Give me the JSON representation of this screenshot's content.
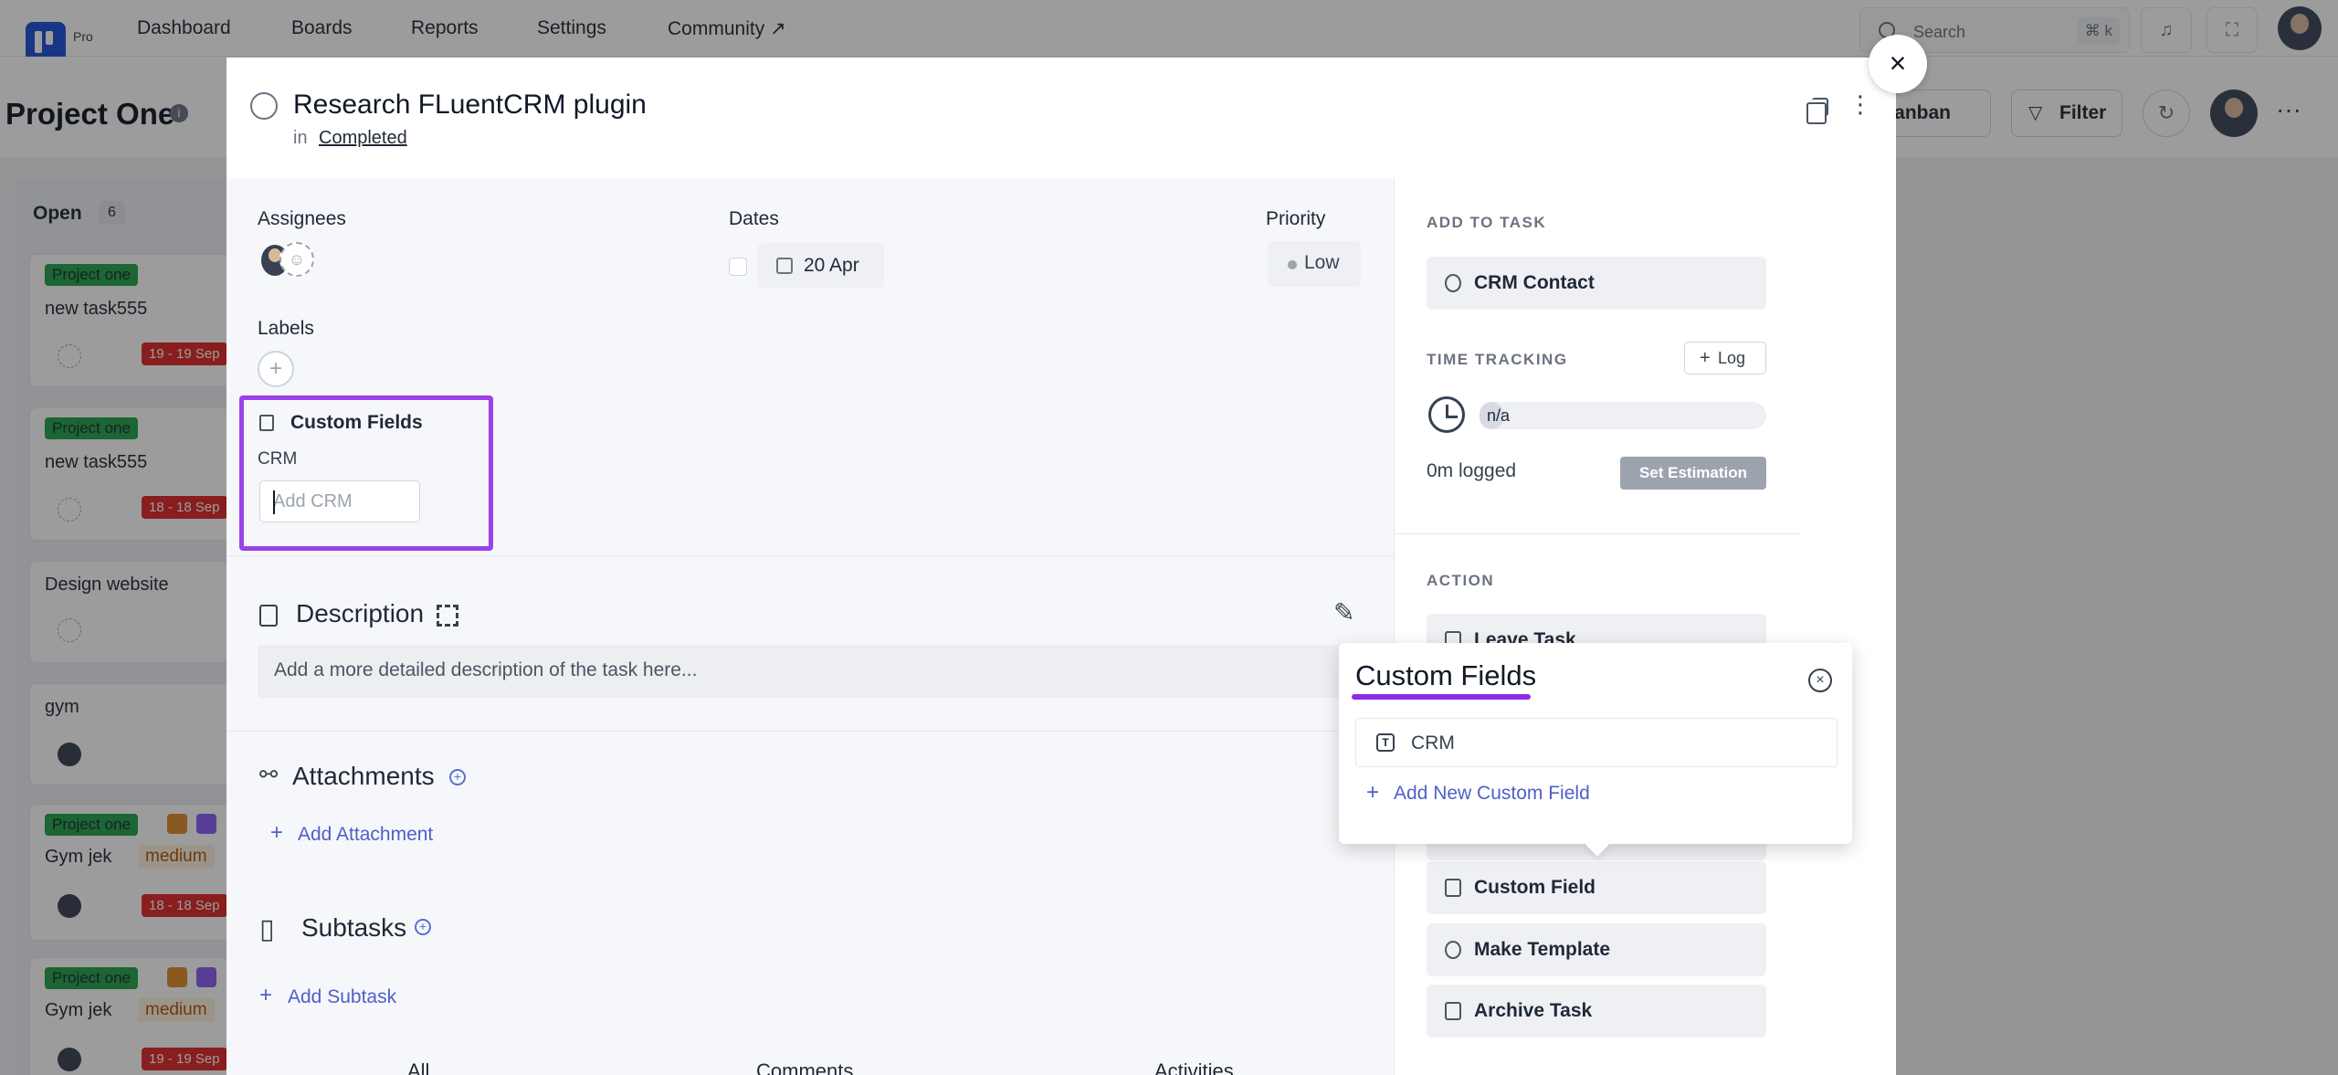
{
  "nav": {
    "pro_badge": "Pro",
    "links": [
      "Dashboard",
      "Boards",
      "Reports",
      "Settings",
      "Community ↗"
    ],
    "search_placeholder": "Search",
    "search_shortcut": "⌘ k"
  },
  "project": {
    "title": "Project One",
    "view_label": "Kanban",
    "view_partial": "anban",
    "filter_label": "Filter"
  },
  "board": {
    "column_title": "Open",
    "column_count": "6",
    "cards": [
      {
        "tag": "Project one",
        "title": "new task555",
        "date": "19 - 19 Sep"
      },
      {
        "tag": "Project one",
        "title": "new task555",
        "date": "18 - 18 Sep"
      },
      {
        "title": "Design website"
      },
      {
        "title": "gym"
      },
      {
        "tag": "Project one",
        "title": "Gym jek",
        "priority": "medium",
        "date": "18 - 18 Sep"
      },
      {
        "tag": "Project one",
        "title": "Gym jek",
        "priority": "medium",
        "date": "19 - 19 Sep"
      }
    ]
  },
  "task": {
    "title": "Research FLuentCRM plugin",
    "in_label": "in",
    "status": "Completed",
    "assignees_label": "Assignees",
    "dates_label": "Dates",
    "date_value": "20 Apr",
    "priority_label": "Priority",
    "priority_value": "Low",
    "labels_label": "Labels",
    "custom_fields_title": "Custom Fields",
    "crm_label": "CRM",
    "crm_placeholder": "Add CRM",
    "description_title": "Description",
    "description_placeholder": "Add a more detailed description of the task here...",
    "attachments_title": "Attachments",
    "add_attachment": "Add Attachment",
    "subtasks_title": "Subtasks",
    "add_subtask": "Add Subtask",
    "tabs": [
      "All",
      "Comments",
      "Activities"
    ]
  },
  "sidebar": {
    "add_to_task_caption": "ADD TO TASK",
    "crm_contact": "CRM Contact",
    "time_tracking_caption": "TIME TRACKING",
    "log_label": "Log",
    "estimate_value": "n/a",
    "logged": "0m logged",
    "set_estimation": "Set Estimation",
    "action_caption": "ACTION",
    "leave_task": "Leave Task",
    "custom_field": "Custom Field",
    "make_template": "Make Template",
    "archive_task": "Archive Task"
  },
  "popover": {
    "title": "Custom Fields",
    "field_name": "CRM",
    "add_new": "Add New Custom Field"
  },
  "colors": {
    "accent_purple": "#9b42e8",
    "link_blue": "#4f5fc9",
    "tag_green": "#22a34a",
    "date_red": "#dc2626"
  }
}
